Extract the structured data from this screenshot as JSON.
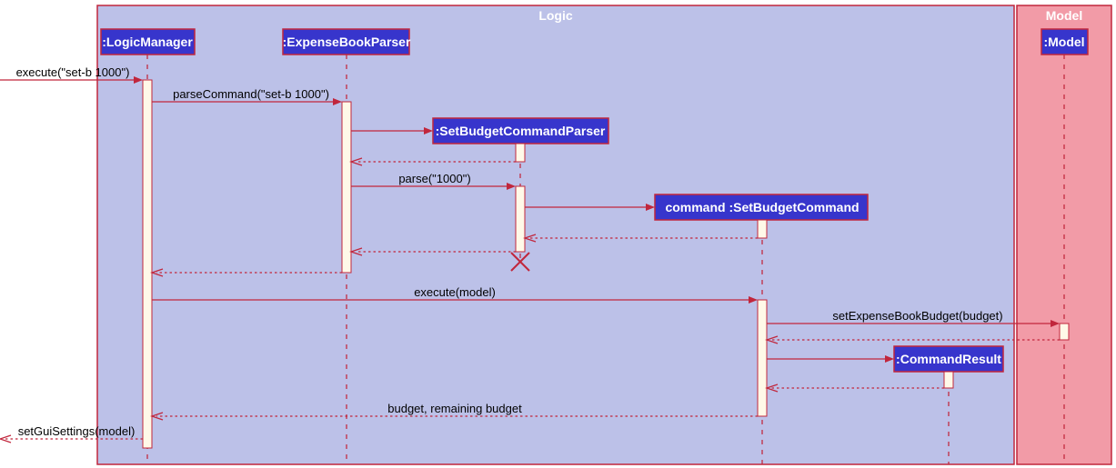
{
  "frames": {
    "logic": "Logic",
    "model": "Model"
  },
  "participants": {
    "logicManager": ":LogicManager",
    "expenseBookParser": ":ExpenseBookParser",
    "setBudgetCommandParser": ":SetBudgetCommandParser",
    "setBudgetCommand": "command :SetBudgetCommand",
    "commandResult": ":CommandResult",
    "model": ":Model"
  },
  "messages": {
    "execute1": "execute(\"set-b 1000\")",
    "parseCommand": "parseCommand(\"set-b 1000\")",
    "parse": "parse(\"1000\")",
    "executeModel": "execute(model)",
    "setExpenseBookBudget": "setExpenseBookBudget(budget)",
    "budgetReturn": "budget, remaining budget",
    "setGuiSettings": "setGuiSettings(model)"
  },
  "diagram": {
    "type": "UML Sequence Diagram"
  }
}
